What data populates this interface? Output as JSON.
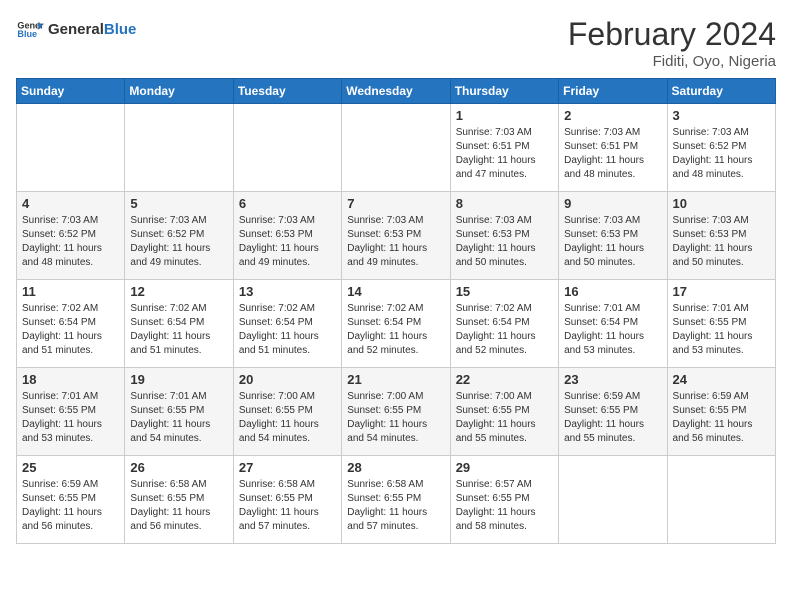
{
  "header": {
    "logo_general": "General",
    "logo_blue": "Blue",
    "month_year": "February 2024",
    "location": "Fiditi, Oyo, Nigeria"
  },
  "days_of_week": [
    "Sunday",
    "Monday",
    "Tuesday",
    "Wednesday",
    "Thursday",
    "Friday",
    "Saturday"
  ],
  "weeks": [
    {
      "cells": [
        {
          "day": "",
          "info": ""
        },
        {
          "day": "",
          "info": ""
        },
        {
          "day": "",
          "info": ""
        },
        {
          "day": "",
          "info": ""
        },
        {
          "day": "1",
          "info": "Sunrise: 7:03 AM\nSunset: 6:51 PM\nDaylight: 11 hours\nand 47 minutes."
        },
        {
          "day": "2",
          "info": "Sunrise: 7:03 AM\nSunset: 6:51 PM\nDaylight: 11 hours\nand 48 minutes."
        },
        {
          "day": "3",
          "info": "Sunrise: 7:03 AM\nSunset: 6:52 PM\nDaylight: 11 hours\nand 48 minutes."
        }
      ]
    },
    {
      "cells": [
        {
          "day": "4",
          "info": "Sunrise: 7:03 AM\nSunset: 6:52 PM\nDaylight: 11 hours\nand 48 minutes."
        },
        {
          "day": "5",
          "info": "Sunrise: 7:03 AM\nSunset: 6:52 PM\nDaylight: 11 hours\nand 49 minutes."
        },
        {
          "day": "6",
          "info": "Sunrise: 7:03 AM\nSunset: 6:53 PM\nDaylight: 11 hours\nand 49 minutes."
        },
        {
          "day": "7",
          "info": "Sunrise: 7:03 AM\nSunset: 6:53 PM\nDaylight: 11 hours\nand 49 minutes."
        },
        {
          "day": "8",
          "info": "Sunrise: 7:03 AM\nSunset: 6:53 PM\nDaylight: 11 hours\nand 50 minutes."
        },
        {
          "day": "9",
          "info": "Sunrise: 7:03 AM\nSunset: 6:53 PM\nDaylight: 11 hours\nand 50 minutes."
        },
        {
          "day": "10",
          "info": "Sunrise: 7:03 AM\nSunset: 6:53 PM\nDaylight: 11 hours\nand 50 minutes."
        }
      ]
    },
    {
      "cells": [
        {
          "day": "11",
          "info": "Sunrise: 7:02 AM\nSunset: 6:54 PM\nDaylight: 11 hours\nand 51 minutes."
        },
        {
          "day": "12",
          "info": "Sunrise: 7:02 AM\nSunset: 6:54 PM\nDaylight: 11 hours\nand 51 minutes."
        },
        {
          "day": "13",
          "info": "Sunrise: 7:02 AM\nSunset: 6:54 PM\nDaylight: 11 hours\nand 51 minutes."
        },
        {
          "day": "14",
          "info": "Sunrise: 7:02 AM\nSunset: 6:54 PM\nDaylight: 11 hours\nand 52 minutes."
        },
        {
          "day": "15",
          "info": "Sunrise: 7:02 AM\nSunset: 6:54 PM\nDaylight: 11 hours\nand 52 minutes."
        },
        {
          "day": "16",
          "info": "Sunrise: 7:01 AM\nSunset: 6:54 PM\nDaylight: 11 hours\nand 53 minutes."
        },
        {
          "day": "17",
          "info": "Sunrise: 7:01 AM\nSunset: 6:55 PM\nDaylight: 11 hours\nand 53 minutes."
        }
      ]
    },
    {
      "cells": [
        {
          "day": "18",
          "info": "Sunrise: 7:01 AM\nSunset: 6:55 PM\nDaylight: 11 hours\nand 53 minutes."
        },
        {
          "day": "19",
          "info": "Sunrise: 7:01 AM\nSunset: 6:55 PM\nDaylight: 11 hours\nand 54 minutes."
        },
        {
          "day": "20",
          "info": "Sunrise: 7:00 AM\nSunset: 6:55 PM\nDaylight: 11 hours\nand 54 minutes."
        },
        {
          "day": "21",
          "info": "Sunrise: 7:00 AM\nSunset: 6:55 PM\nDaylight: 11 hours\nand 54 minutes."
        },
        {
          "day": "22",
          "info": "Sunrise: 7:00 AM\nSunset: 6:55 PM\nDaylight: 11 hours\nand 55 minutes."
        },
        {
          "day": "23",
          "info": "Sunrise: 6:59 AM\nSunset: 6:55 PM\nDaylight: 11 hours\nand 55 minutes."
        },
        {
          "day": "24",
          "info": "Sunrise: 6:59 AM\nSunset: 6:55 PM\nDaylight: 11 hours\nand 56 minutes."
        }
      ]
    },
    {
      "cells": [
        {
          "day": "25",
          "info": "Sunrise: 6:59 AM\nSunset: 6:55 PM\nDaylight: 11 hours\nand 56 minutes."
        },
        {
          "day": "26",
          "info": "Sunrise: 6:58 AM\nSunset: 6:55 PM\nDaylight: 11 hours\nand 56 minutes."
        },
        {
          "day": "27",
          "info": "Sunrise: 6:58 AM\nSunset: 6:55 PM\nDaylight: 11 hours\nand 57 minutes."
        },
        {
          "day": "28",
          "info": "Sunrise: 6:58 AM\nSunset: 6:55 PM\nDaylight: 11 hours\nand 57 minutes."
        },
        {
          "day": "29",
          "info": "Sunrise: 6:57 AM\nSunset: 6:55 PM\nDaylight: 11 hours\nand 58 minutes."
        },
        {
          "day": "",
          "info": ""
        },
        {
          "day": "",
          "info": ""
        }
      ]
    }
  ]
}
